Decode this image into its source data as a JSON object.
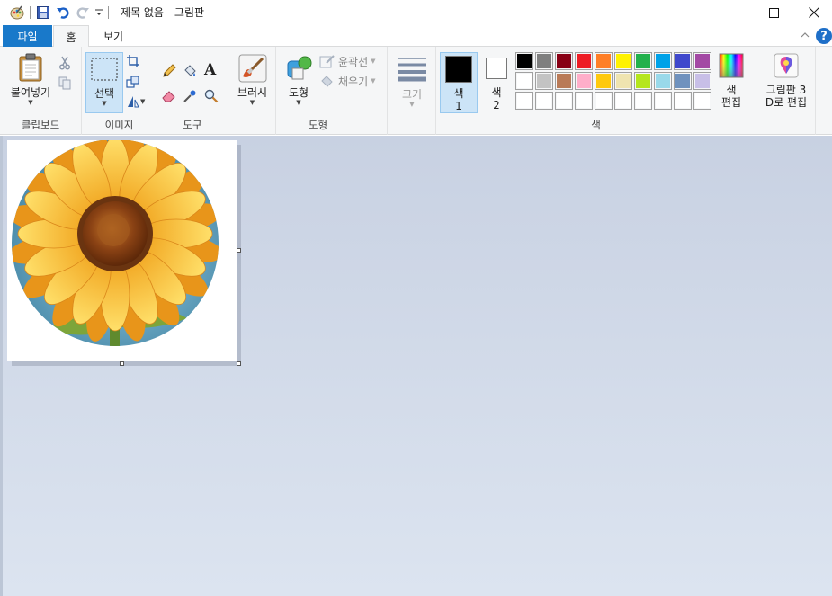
{
  "window": {
    "title": "제목 없음 - 그림판",
    "minimize_glyph": "—",
    "maximize_glyph": "☐",
    "close_glyph": "✕"
  },
  "tabs": {
    "file": "파일",
    "home": "홈",
    "view": "보기"
  },
  "help_glyph": "?",
  "clipboard": {
    "paste_label": "붙여넣기",
    "group_label": "클립보드"
  },
  "image": {
    "select_label": "선택",
    "group_label": "이미지"
  },
  "tools": {
    "text_glyph": "A",
    "group_label": "도구"
  },
  "brushes": {
    "label": "브러시"
  },
  "shapes": {
    "shapes_label": "도형",
    "outline_label": "윤곽선",
    "fill_label": "채우기",
    "group_label": "도형"
  },
  "size": {
    "label": "크기"
  },
  "colors": {
    "color1_label": "색",
    "color1_num": "1",
    "color2_label": "색",
    "color2_num": "2",
    "edit_label_1": "색",
    "edit_label_2": "편집",
    "group_label": "색",
    "color1_value": "#000000",
    "color2_value": "#ffffff",
    "palette_row1": [
      "#000000",
      "#7f7f7f",
      "#880015",
      "#ed1c24",
      "#ff7f27",
      "#fff200",
      "#22b14c",
      "#00a2e8",
      "#3f48cc",
      "#a349a4"
    ],
    "palette_row2": [
      "#ffffff",
      "#c3c3c3",
      "#b97a57",
      "#ffaec9",
      "#ffc90e",
      "#efe4b0",
      "#b5e61d",
      "#99d9ea",
      "#7092be",
      "#c8bfe7"
    ],
    "palette_row3": [
      "#ffffff",
      "#ffffff",
      "#ffffff",
      "#ffffff",
      "#ffffff",
      "#ffffff",
      "#ffffff",
      "#ffffff",
      "#ffffff",
      "#ffffff"
    ]
  },
  "paint3d": {
    "label_1": "그림판 3",
    "label_2": "D로 편집"
  }
}
